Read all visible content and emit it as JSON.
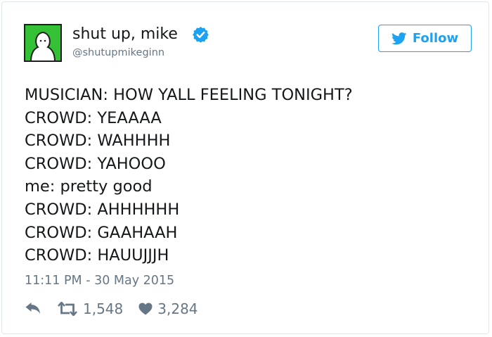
{
  "tweet": {
    "author_name": "shut up, mike",
    "handle": "@shutupmikeginn",
    "follow_label": "Follow",
    "lines": [
      "MUSICIAN: HOW YALL FEELING TONIGHT?",
      "CROWD: YEAAAA",
      "CROWD: WAHHHH",
      "CROWD: YAHOOO",
      "me: pretty good",
      "CROWD: AHHHHHH",
      "CROWD: GAAHAAH",
      "CROWD: HAUUJJJH"
    ],
    "timestamp": "11:11 PM - 30 May 2015",
    "retweets": "1,548",
    "likes": "3,284"
  },
  "icons": {
    "avatar": "ghost-avatar-icon",
    "verified": "verified-badge-icon",
    "follow": "twitter-bird-icon",
    "reply": "reply-icon",
    "retweet": "retweet-icon",
    "like": "heart-icon"
  },
  "colors": {
    "accent": "#1da1f2",
    "avatar_bg": "#35c135",
    "text": "#14171a",
    "muted": "#657786",
    "border": "#e1e8ed"
  }
}
